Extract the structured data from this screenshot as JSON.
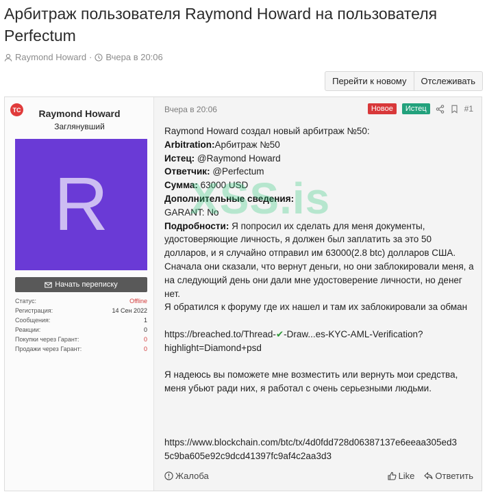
{
  "page": {
    "title": "Арбитраж пользователя Raymond Howard на пользователя Perfectum",
    "meta_author": "Raymond Howard",
    "meta_separator": "·",
    "meta_date": "Вчера в 20:06"
  },
  "top_actions": {
    "goto_new": "Перейти к новому",
    "watch": "Отслеживать"
  },
  "user": {
    "forum_logo": "TC",
    "name": "Raymond Howard",
    "title": "Заглянувший",
    "avatar_letter": "R",
    "avatar_color": "#6a3ad6",
    "pm_button": "Начать переписку",
    "stats": [
      {
        "label": "Статус:",
        "value": "Offline"
      },
      {
        "label": "Регистрация:",
        "value": "14 Сен 2022"
      },
      {
        "label": "Сообщения:",
        "value": "1"
      },
      {
        "label": "Реакции:",
        "value": "0"
      },
      {
        "label": "Покупки через Гарант:",
        "value": "0"
      },
      {
        "label": "Продажи через Гарант:",
        "value": "0"
      }
    ]
  },
  "post": {
    "date": "Вчера в 20:06",
    "badge_new": "Новое",
    "badge_plaintiff": "Истец",
    "number": "#1",
    "intro": "Raymond Howard создал новый арбитраж №50:",
    "arbitration_label": "Arbitration:",
    "arbitration_value": "Арбитраж №50",
    "plaintiff_label": "Истец:",
    "plaintiff_value": " @Raymond Howard",
    "defendant_label": "Ответчик:",
    "defendant_value": " @Perfectum",
    "amount_label": "Сумма:",
    "amount_value": " 63000 USD",
    "extra_label": "Дополнительные сведения:",
    "garant": "GARANT: No",
    "details_label": "Подробности:",
    "details_text": " Я попросил их сделать для меня документы, удостоверяющие личность, я должен был заплатить за это 50 долларов, и я случайно отправил им 63000(2.8 btc) долларов США. Сначала они сказали, что вернут деньги, но они заблокировали меня, а на следующий день они дали мне удостоверение личности, но денег нет.",
    "forum_line": "Я обратился к форуму где их нашел и там их заблокировали за обман",
    "link1_a": "https://breached.to/Thread-",
    "link1_check": "✔",
    "link1_b": "-Draw...es-KYC-AML-Verification?",
    "link1_c": "highlight=Diamond+psd",
    "hope_text": "Я надеюсь вы поможете мне возместить или вернуть мои средства, меня убьют ради них, я работал с очень серьезными людьми.",
    "link2_a": "https://www.blockchain.com/btc/tx/4d0fdd728d06387137e6eeaa305ed3",
    "link2_b": "5c9ba605e92c9dcd41397fc9af4c2aa3d3"
  },
  "watermark": "XSS.is",
  "footer": {
    "report": "Жалоба",
    "like": "Like",
    "reply": "Ответить"
  }
}
